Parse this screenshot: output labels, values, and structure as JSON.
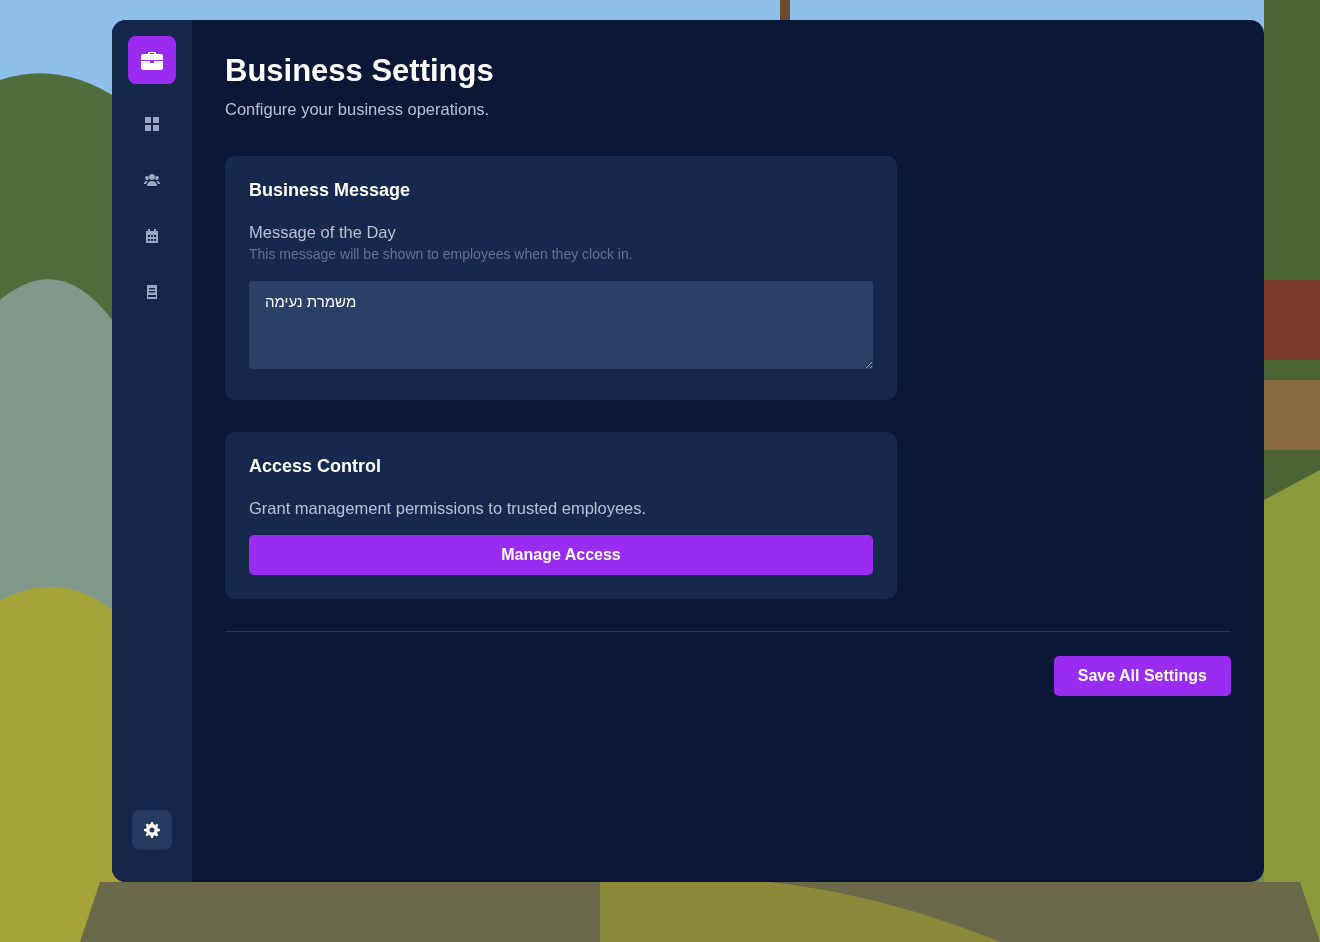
{
  "sidebar": {
    "items": [
      {
        "kind": "grid",
        "selected": false
      },
      {
        "kind": "people",
        "selected": false
      },
      {
        "kind": "calendar",
        "selected": false
      },
      {
        "kind": "book",
        "selected": false
      }
    ],
    "footer_items": [
      {
        "kind": "gear",
        "selected": true
      }
    ]
  },
  "header": {
    "title": "Business Settings",
    "subtitle": "Configure your business operations."
  },
  "cards": [
    {
      "kind": "message",
      "title": "Business Message",
      "label": "Message of the Day",
      "hint": "This message will be shown to employees when they clock in.",
      "value": "משמרת נעימה"
    },
    {
      "kind": "action",
      "title": "Access Control",
      "text": "Grant management permissions to trusted employees.",
      "button": "Manage Access"
    }
  ],
  "save_button": "Save All Settings"
}
